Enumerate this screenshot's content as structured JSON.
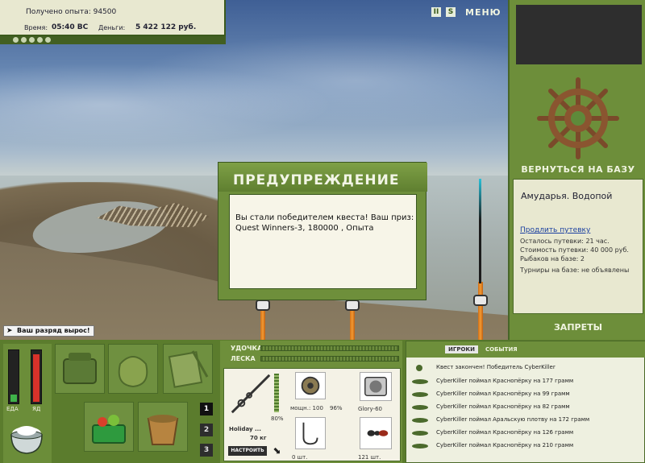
{
  "top_info": {
    "xp_label": "Получено опыта: 94500",
    "time_label": "Время:",
    "time_value": "05:40 ВС",
    "money_label": "Деньги:",
    "money_value": "5 422 122 руб."
  },
  "controls": {
    "pause_label": "II",
    "sound_label": "S",
    "menu_label": "МЕНЮ"
  },
  "right_panel": {
    "back_button": "ВЕРНУТЬСЯ НА БАЗУ",
    "location_name": "Амударья. Водопой",
    "extend_link": "Продлить путевку",
    "time_left": "Осталось путевки: 21 час.",
    "ticket_cost": "Стоимость путевки: 40 000 руб.",
    "anglers": "Рыбаков на базе: 2",
    "tournaments": "Турниры на базе: не объявлены",
    "bans_button": "ЗАПРЕТЫ"
  },
  "notification": {
    "rank_up": "Ваш разряд вырос!"
  },
  "dialog": {
    "title": "ПРЕДУПРЕЖДЕНИЕ",
    "message": "Вы стали победителем квеста! Ваш приз: Quest Winners-3, 180000 , Опыта"
  },
  "status_meters": {
    "food_label": "ЕДА",
    "poison_label": "ЯД",
    "food_level": 0.15,
    "poison_level": 0.95
  },
  "inventory": {
    "pages": [
      "1",
      "2",
      "3"
    ],
    "active_page": "1"
  },
  "rod_panel": {
    "rod_label": "УДОЧКА",
    "line_label": "ЛЕСКА",
    "rod_name": "Holiday ...",
    "rod_weight": "70 кг",
    "rod_condition": "80%",
    "reel_power": "мощн.: 100",
    "reel_condition": "96%",
    "line_name": "Glory-60",
    "hooks_count": "0 шт.",
    "bait_count": "121 шт.",
    "setup_button": "НАСТРОИТЬ"
  },
  "log_panel": {
    "tabs": [
      "ИГРОКИ",
      "СОБЫТИЯ"
    ],
    "active_tab": "ИГРОКИ",
    "header": "Квест закончен! Победитель CyberKiller",
    "entries": [
      "CyberKiller поймал Краснопёрку на 177 грамм",
      "CyberKiller поймал Краснопёрку на 99 грамм",
      "CyberKiller поймал Краснопёрку на 82 грамм",
      "CyberKiller поймал Аральскую плотву на 172 грамм",
      "CyberKiller поймал Краснопёрку на 126 грамм",
      "CyberKiller поймал Краснопёрку на 210 грамм"
    ]
  },
  "colors": {
    "panel_green": "#6e8f3b",
    "dark_green": "#3a5720",
    "paper": "#e8e8d0",
    "rod_orange": "#f39a32"
  }
}
